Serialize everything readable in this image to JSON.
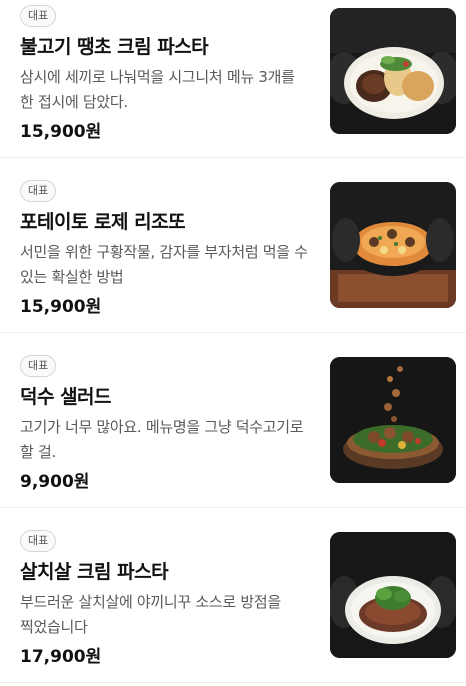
{
  "menu": {
    "items": [
      {
        "badge": "대표",
        "name": "불고기 땡초 크림 파스타",
        "description": "삼시에 세끼로 나눠먹을 시그니처 메뉴 3개를 한 접시에 담았다.",
        "price": "15,900원",
        "image": "pasta-trio-plate"
      },
      {
        "badge": "대표",
        "name": "포테이토 로제 리조또",
        "description": "서민을 위한 구황작물, 감자를 부자처럼 먹을 수 있는 확실한 방법",
        "price": "15,900원",
        "image": "risotto-skillet"
      },
      {
        "badge": "대표",
        "name": "덕수 샐러드",
        "description": "고기가 너무 많아요. 메뉴명을 그냥 덕수고기로 할 걸.",
        "price": "9,900원",
        "image": "salad-bowl"
      },
      {
        "badge": "대표",
        "name": "살치살 크림 파스타",
        "description": "부드러운 살치살에 야끼니꾸 소스로 방점을 찍었습니다",
        "price": "17,900원",
        "image": "steak-pasta-plate"
      }
    ]
  }
}
